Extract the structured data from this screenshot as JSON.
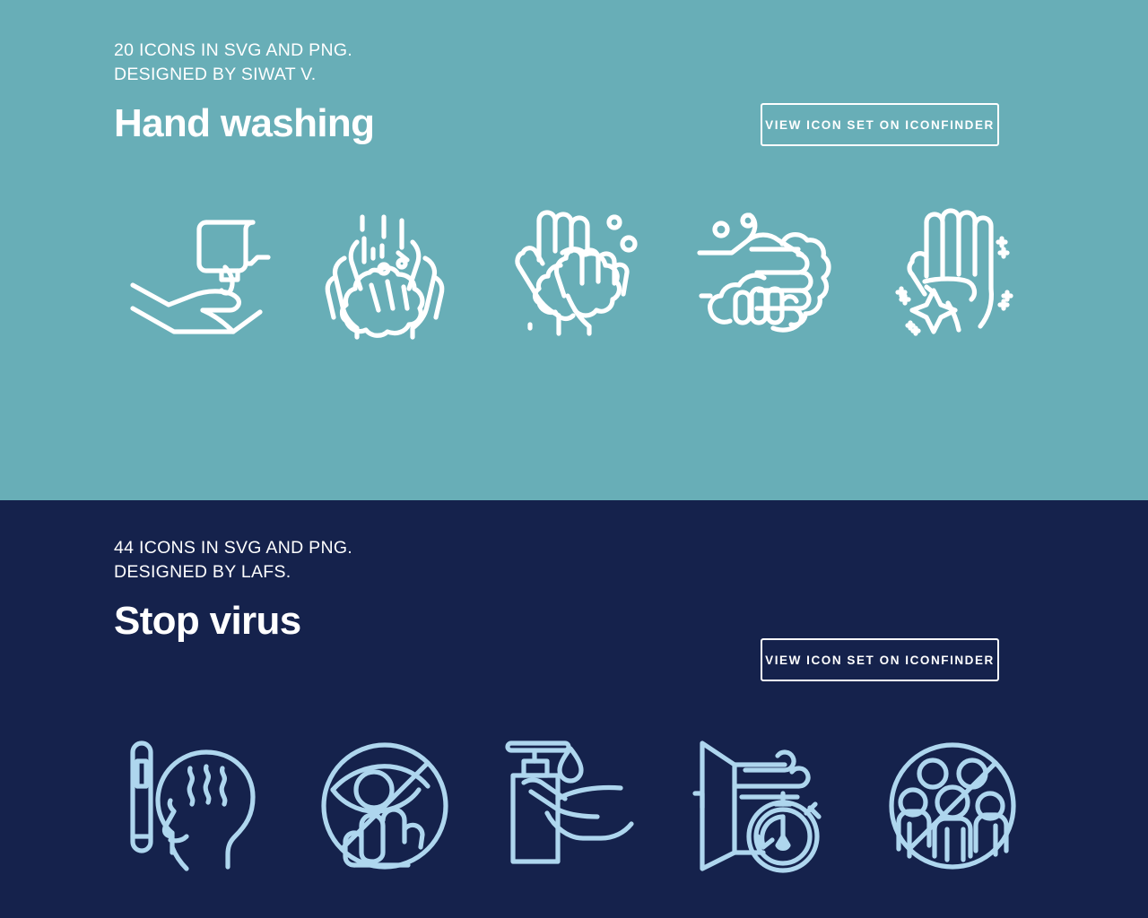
{
  "sections": [
    {
      "id": "hand-washing",
      "meta_line_1": "20 ICONS IN SVG AND PNG.",
      "meta_line_2": "DESIGNED BY SIWAT V.",
      "title": "Hand washing",
      "cta_label": "VIEW ICON SET ON ICONFINDER",
      "background_color": "#68aeb7",
      "icon_color": "#ffffff",
      "text_color": "#ffffff",
      "icons": [
        {
          "name": "wall-soap-dispenser-with-hand-icon",
          "label": "Wall soap dispenser with open hand"
        },
        {
          "name": "cupped-hands-with-water-and-foam-icon",
          "label": "Cupped hands rinsing with water droplets"
        },
        {
          "name": "palm-to-palm-washing-with-foam-icon",
          "label": "Palm rubbing against palm with soap foam"
        },
        {
          "name": "interlaced-fingers-washing-icon",
          "label": "Interlaced fingers washing with foam"
        },
        {
          "name": "clean-sparkling-hand-icon",
          "label": "Clean hand with sparkles"
        }
      ]
    },
    {
      "id": "stop-virus",
      "meta_line_1": "44 ICONS IN SVG AND PNG.",
      "meta_line_2": "DESIGNED BY LAFS.",
      "title": "Stop virus",
      "cta_label": "VIEW ICON SET ON ICONFINDER",
      "background_color": "#15224c",
      "icon_color": "#aed6ee",
      "text_color": "#ffffff",
      "icons": [
        {
          "name": "thermometer-fever-head-icon",
          "label": "Thermometer next to head with fever"
        },
        {
          "name": "do-not-touch-eyes-icon",
          "label": "Do not touch your eyes"
        },
        {
          "name": "soap-pump-bottle-hand-icon",
          "label": "Soap pump bottle with hand and droplet"
        },
        {
          "name": "ventilate-room-timer-icon",
          "label": "Open window airflow with stopwatch"
        },
        {
          "name": "avoid-crowds-icon",
          "label": "Avoid crowds of people"
        }
      ]
    }
  ]
}
